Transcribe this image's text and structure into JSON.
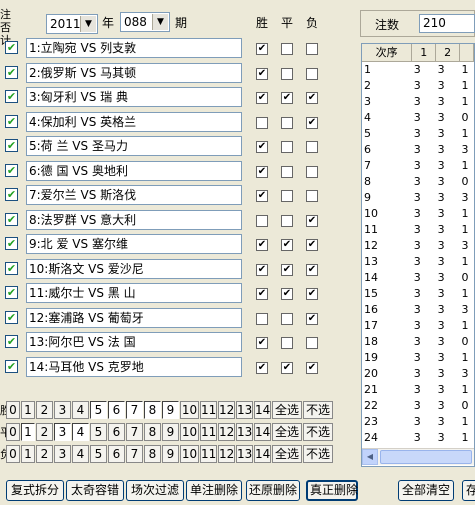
{
  "left_label": "注否计",
  "year": {
    "value": "2011",
    "label": "年"
  },
  "period": {
    "value": "088",
    "label": "期"
  },
  "columns": [
    "胜",
    "平",
    "负"
  ],
  "matches": [
    {
      "check": true,
      "text": "1:立陶宛 VS 列支敦",
      "w": true,
      "d": false,
      "l": false
    },
    {
      "check": true,
      "text": "2:俄罗斯 VS 马其顿",
      "w": true,
      "d": false,
      "l": false
    },
    {
      "check": true,
      "text": "3:匈牙利 VS 瑞  典",
      "w": true,
      "d": true,
      "l": true
    },
    {
      "check": true,
      "text": "4:保加利 VS 英格兰",
      "w": false,
      "d": false,
      "l": true
    },
    {
      "check": true,
      "text": "5:荷  兰 VS 圣马力",
      "w": true,
      "d": false,
      "l": false
    },
    {
      "check": true,
      "text": "6:德  国 VS 奥地利",
      "w": true,
      "d": false,
      "l": false
    },
    {
      "check": true,
      "text": "7:爱尔兰 VS 斯洛伐",
      "w": true,
      "d": false,
      "l": false
    },
    {
      "check": true,
      "text": "8:法罗群 VS 意大利",
      "w": false,
      "d": false,
      "l": true
    },
    {
      "check": true,
      "text": "9:北  爱 VS 塞尔维",
      "w": true,
      "d": true,
      "l": true
    },
    {
      "check": true,
      "text": "10:斯洛文 VS 爱沙尼",
      "w": true,
      "d": true,
      "l": true
    },
    {
      "check": true,
      "text": "11:威尔士 VS 黑  山",
      "w": true,
      "d": true,
      "l": true
    },
    {
      "check": true,
      "text": "12:塞浦路 VS 葡萄牙",
      "w": false,
      "d": false,
      "l": true
    },
    {
      "check": true,
      "text": "13:阿尔巴 VS 法  国",
      "w": true,
      "d": false,
      "l": false
    },
    {
      "check": true,
      "text": "14:马耳他 VS 克罗地",
      "w": true,
      "d": true,
      "l": true
    }
  ],
  "number_rows": [
    {
      "label": "胜",
      "buttons": [
        "0",
        "1",
        "2",
        "3",
        "4",
        "5",
        "6",
        "7",
        "8",
        "9",
        "10",
        "11",
        "12",
        "13",
        "14"
      ],
      "pressed": [
        5,
        6,
        7,
        8,
        9
      ],
      "select_all": "全选",
      "select_none": "不选"
    },
    {
      "label": "平",
      "buttons": [
        "0",
        "1",
        "2",
        "3",
        "4",
        "5",
        "6",
        "7",
        "8",
        "9",
        "10",
        "11",
        "12",
        "13",
        "14"
      ],
      "pressed": [
        1,
        3,
        4
      ],
      "select_all": "全选",
      "select_none": "不选"
    },
    {
      "label": "负",
      "buttons": [
        "0",
        "1",
        "2",
        "3",
        "4",
        "5",
        "6",
        "7",
        "8",
        "9",
        "10",
        "11",
        "12",
        "13",
        "14"
      ],
      "pressed": [],
      "select_all": "全选",
      "select_none": "不选"
    }
  ],
  "bottom_buttons": [
    "复式拆分",
    "太奇容错",
    "场次过滤",
    "单注删除",
    "还原删除",
    "真正删除",
    "全部清空",
    "存"
  ],
  "count": {
    "label": "注数",
    "value": "210"
  },
  "grid": {
    "headers": [
      "次序",
      "1",
      "2"
    ],
    "rows": [
      [
        "1",
        "3",
        "3",
        "1"
      ],
      [
        "2",
        "3",
        "3",
        "1"
      ],
      [
        "3",
        "3",
        "3",
        "1"
      ],
      [
        "4",
        "3",
        "3",
        "0"
      ],
      [
        "5",
        "3",
        "3",
        "1"
      ],
      [
        "6",
        "3",
        "3",
        "3"
      ],
      [
        "7",
        "3",
        "3",
        "1"
      ],
      [
        "8",
        "3",
        "3",
        "0"
      ],
      [
        "9",
        "3",
        "3",
        "3"
      ],
      [
        "10",
        "3",
        "3",
        "1"
      ],
      [
        "11",
        "3",
        "3",
        "1"
      ],
      [
        "12",
        "3",
        "3",
        "3"
      ],
      [
        "13",
        "3",
        "3",
        "1"
      ],
      [
        "14",
        "3",
        "3",
        "0"
      ],
      [
        "15",
        "3",
        "3",
        "1"
      ],
      [
        "16",
        "3",
        "3",
        "3"
      ],
      [
        "17",
        "3",
        "3",
        "1"
      ],
      [
        "18",
        "3",
        "3",
        "0"
      ],
      [
        "19",
        "3",
        "3",
        "1"
      ],
      [
        "20",
        "3",
        "3",
        "3"
      ],
      [
        "21",
        "3",
        "3",
        "1"
      ],
      [
        "22",
        "3",
        "3",
        "0"
      ],
      [
        "23",
        "3",
        "3",
        "1"
      ],
      [
        "24",
        "3",
        "3",
        "1"
      ]
    ]
  }
}
